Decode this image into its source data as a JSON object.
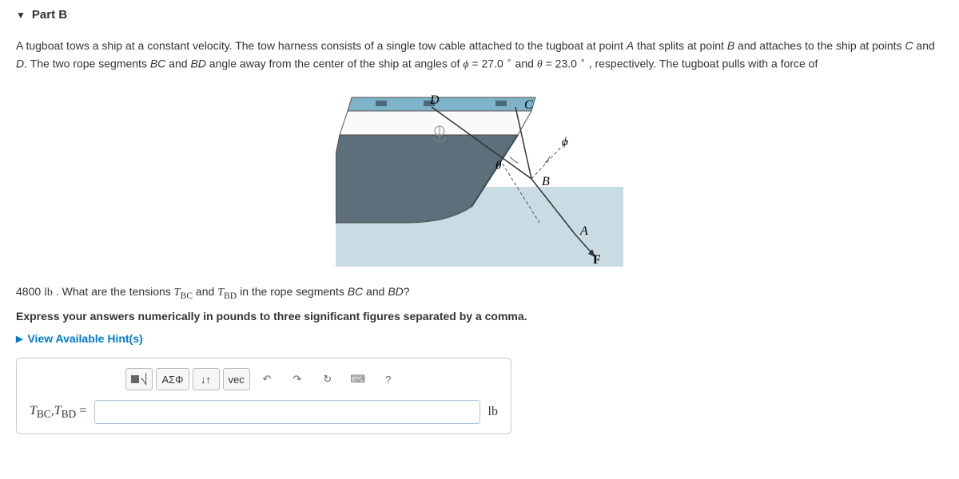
{
  "section": {
    "title": "Part B"
  },
  "problem": {
    "text_1a": "A tugboat tows a ship at a constant velocity.  The tow harness consists of a single tow cable attached to the tugboat at point ",
    "pt_A": "A",
    "text_1b": " that splits at point ",
    "pt_B": "B",
    "text_1c": " and attaches to the ship at points ",
    "pt_C": "C",
    "text_1d": " and ",
    "pt_D": "D",
    "text_1e": ".  The two rope segments ",
    "seg_BC": "BC",
    "text_1f": " and ",
    "seg_BD": "BD",
    "text_1g": " angle away from the center of the ship at angles of ",
    "phi_sym": "ϕ",
    "eq1": " = 27.0 ",
    "deg": "∘",
    "text_and": " and ",
    "theta_sym": "θ",
    "eq2": " = 23.0 ",
    "text_tail": " , respectively.  The tugboat pulls with a force of"
  },
  "diagram": {
    "label_D": "D",
    "label_C": "C",
    "label_theta": "θ",
    "label_phi": "ϕ",
    "label_B": "B",
    "label_A": "A",
    "label_F": "F"
  },
  "question": {
    "force_val": "4800 ",
    "force_unit": "lb",
    "q_a": " .  What are the tensions ",
    "tbc": "T",
    "tbc_sub": "BC",
    "q_b": " and ",
    "tbd": "T",
    "tbd_sub": "BD",
    "q_c": " in the rope segments ",
    "seg_BC": "BC",
    "q_d": " and ",
    "seg_BD": "BD",
    "q_e": "?"
  },
  "instruction": "Express your answers numerically in pounds to three significant figures separated by a comma.",
  "hints": "View Available Hint(s)",
  "toolbar": {
    "templates": "⎷",
    "greek": "ΑΣΦ",
    "subsup": "↓↑",
    "vec": "vec",
    "undo": "↶",
    "redo": "↷",
    "reset": "↻",
    "keyboard": "⌨",
    "help": "?"
  },
  "answer": {
    "label_T1": "T",
    "label_T1sub": "BC",
    "comma": ",",
    "label_T2": "T",
    "label_T2sub": "BD",
    "equals": " = ",
    "value": "",
    "unit": "lb"
  }
}
